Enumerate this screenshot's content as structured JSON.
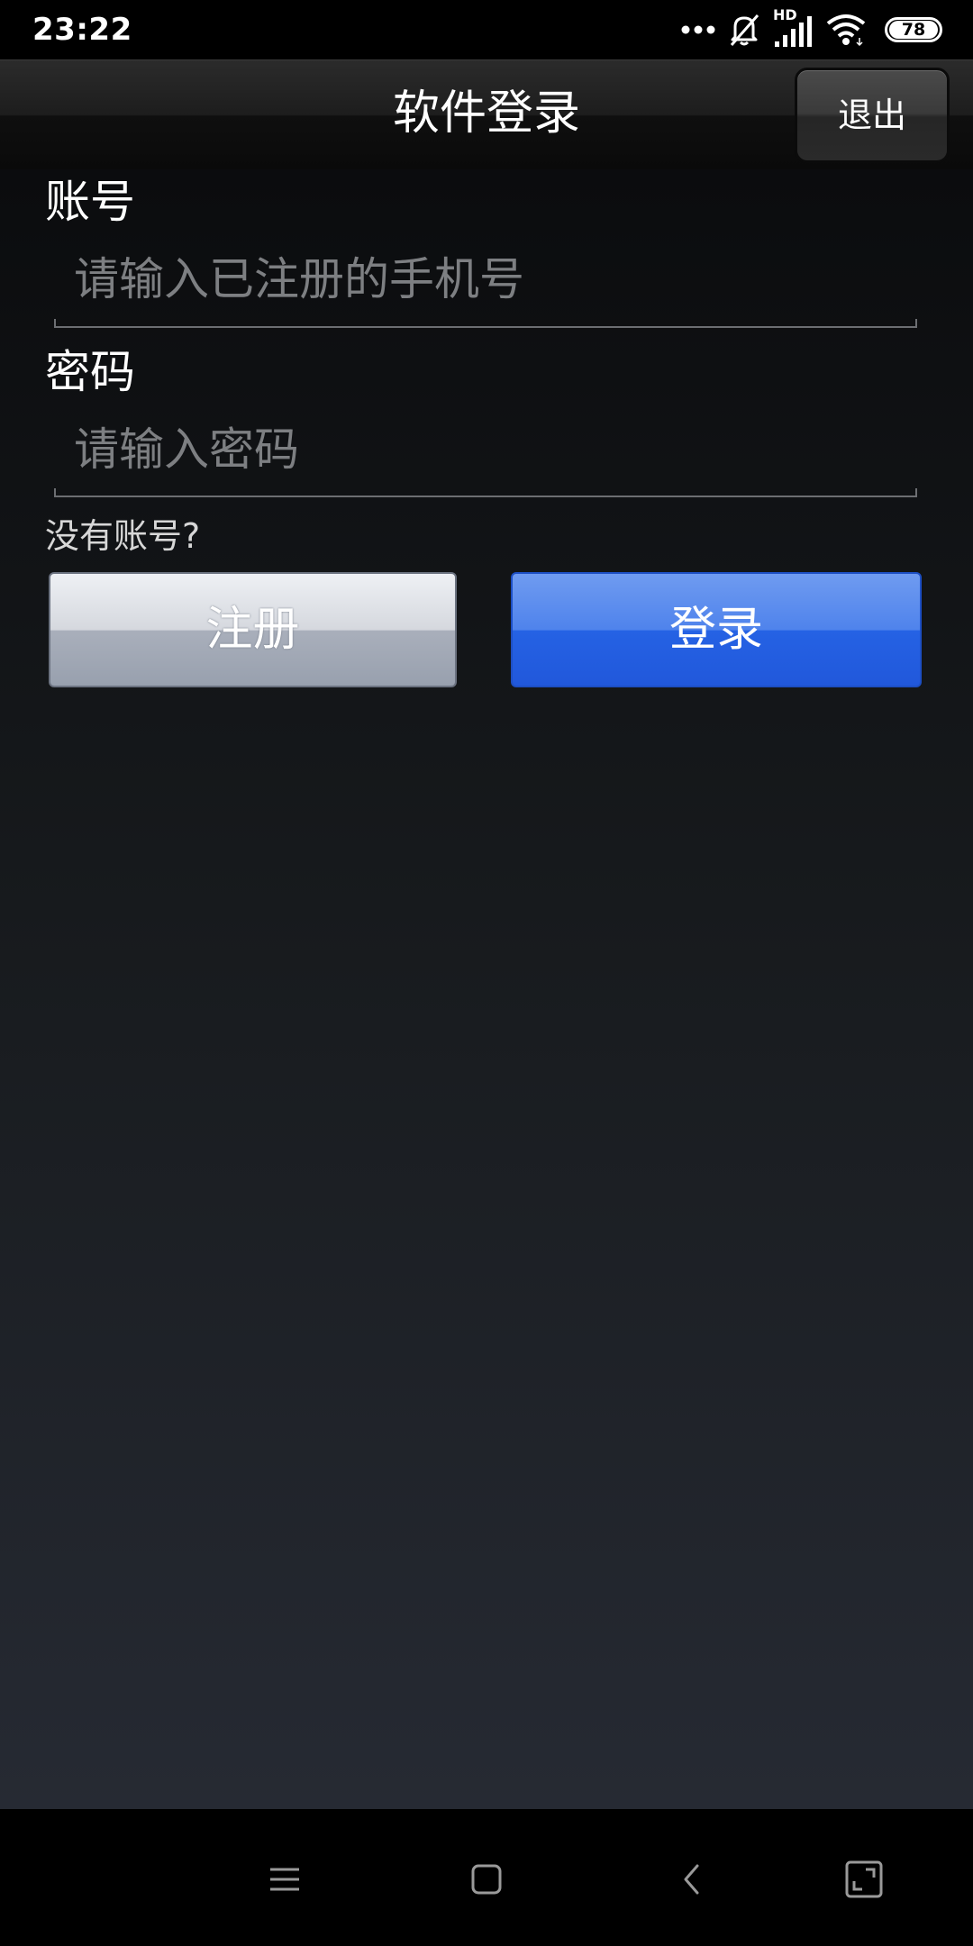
{
  "status_bar": {
    "time": "23:22",
    "network_label": "HD",
    "battery": "78",
    "icons": [
      "more-dots-icon",
      "bell-muted-icon",
      "signal-icon",
      "wifi-icon",
      "battery-icon"
    ]
  },
  "title_bar": {
    "title": "软件登录",
    "exit_label": "退出"
  },
  "form": {
    "account_label": "账号",
    "account_placeholder": "请输入已注册的手机号",
    "password_label": "密码",
    "password_placeholder": "请输入密码",
    "no_account_text": "没有账号?",
    "register_label": "注册",
    "login_label": "登录"
  },
  "nav_bar": {
    "icons": [
      "menu-icon",
      "home-icon",
      "back-icon",
      "screenshot-icon"
    ]
  },
  "colors": {
    "login_button": "#2562e4",
    "register_button": "#a9afbb",
    "background_top": "#0b0c0e",
    "background_bottom": "#262a33"
  }
}
